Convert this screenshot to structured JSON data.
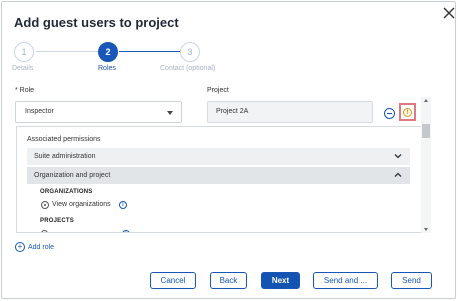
{
  "dialog": {
    "title": "Add guest users to project"
  },
  "stepper": {
    "steps": [
      {
        "number": "1",
        "label": "Details",
        "state": "inactive"
      },
      {
        "number": "2",
        "label": "Roles",
        "state": "active"
      },
      {
        "number": "3",
        "label": "Contact (optional)",
        "state": "inactive"
      }
    ]
  },
  "role": {
    "label": "* Role",
    "value": "Inspector"
  },
  "project": {
    "label": "Project",
    "value": "Project 2A"
  },
  "permissions": {
    "title": "Associated permissions",
    "suite": "Suite administration",
    "org_and_project": "Organization and project",
    "organizations_heading": "ORGANIZATIONS",
    "view_organizations": "View organizations",
    "projects_heading": "PROJECTS"
  },
  "add_role": "Add role",
  "footer": {
    "cancel": "Cancel",
    "back": "Back",
    "next": "Next",
    "send_and": "Send and ...",
    "send": "Send"
  },
  "colors": {
    "primary": "#1354b2",
    "warning_border": "#e07882",
    "warning_icon": "#d29a26"
  },
  "icons": {
    "close": "close-icon",
    "remove": "minus-circle-icon",
    "warning": "warning-icon",
    "info": "info-icon",
    "chevron_down": "chevron-down-icon",
    "chevron_up": "chevron-up-icon",
    "add": "plus-circle-icon"
  }
}
